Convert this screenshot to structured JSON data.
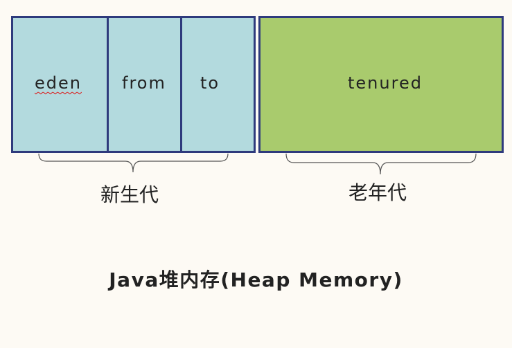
{
  "young_generation": {
    "regions": [
      {
        "id": "eden",
        "label": "eden"
      },
      {
        "id": "from",
        "label": "from"
      },
      {
        "id": "to",
        "label": "to"
      }
    ],
    "label": "新生代"
  },
  "old_generation": {
    "regions": [
      {
        "id": "tenured",
        "label": "tenured"
      }
    ],
    "label": "老年代"
  },
  "title": "Java堆内存(Heap Memory)",
  "colors": {
    "young_fill": "#b3dade",
    "old_fill": "#a9cb6d",
    "border": "#2e3a7c",
    "background": "#fdfaf4"
  }
}
